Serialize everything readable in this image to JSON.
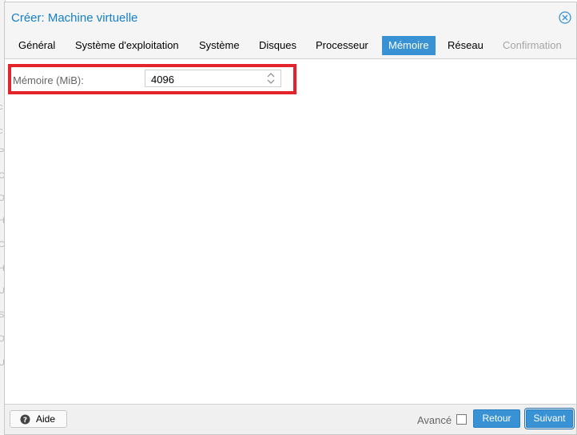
{
  "window": {
    "title": "Créer: Machine virtuelle"
  },
  "tabs": [
    {
      "label": "Général",
      "state": "normal"
    },
    {
      "label": "Système d'exploitation",
      "state": "normal"
    },
    {
      "label": "Système",
      "state": "normal"
    },
    {
      "label": "Disques",
      "state": "normal"
    },
    {
      "label": "Processeur",
      "state": "normal"
    },
    {
      "label": "Mémoire",
      "state": "active"
    },
    {
      "label": "Réseau",
      "state": "normal"
    },
    {
      "label": "Confirmation",
      "state": "disabled"
    }
  ],
  "form": {
    "memory_label": "Mémoire (MiB):",
    "memory_value": "4096"
  },
  "footer": {
    "help_label": "Aide",
    "advanced_label": "Avancé",
    "advanced_checked": false,
    "back_label": "Retour",
    "next_label": "Suivant"
  },
  "icons": {
    "close": "close-circle-icon",
    "help": "question-circle-icon",
    "spinner": "chevron-up-down-icon"
  },
  "colors": {
    "accent": "#3892d4",
    "title": "#157fcc",
    "highlight": "#e3242b"
  }
}
